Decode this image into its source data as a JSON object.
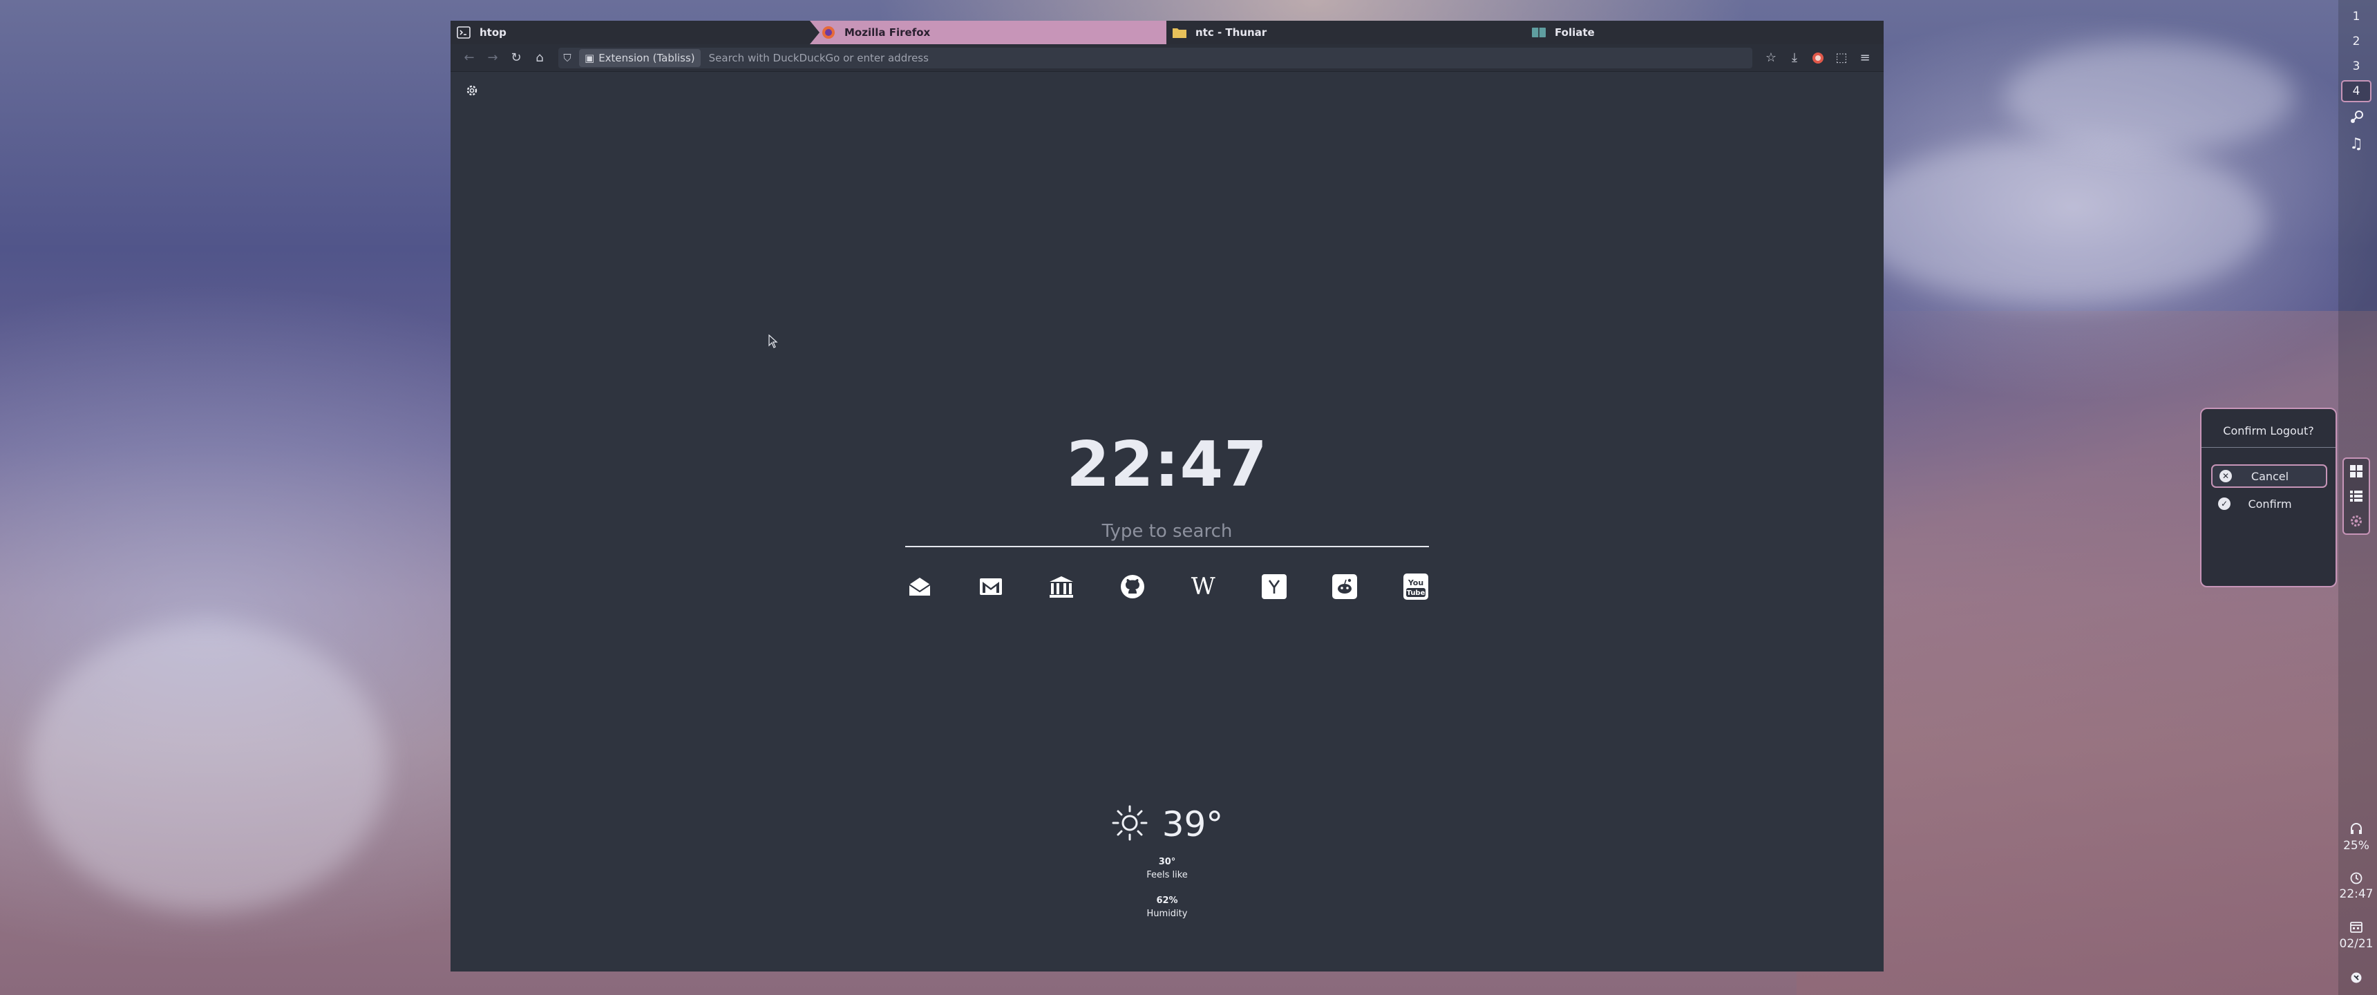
{
  "wm_tabs": [
    {
      "title": "htop",
      "icon": "terminal-icon"
    },
    {
      "title": "Mozilla Firefox",
      "icon": "firefox-icon",
      "active": true
    },
    {
      "title": "ntc - Thunar",
      "icon": "folder-icon"
    },
    {
      "title": "Foliate",
      "icon": "book-icon"
    }
  ],
  "browser": {
    "extension_chip": "Extension (Tabliss)",
    "url_placeholder": "Search with DuckDuckGo or enter address"
  },
  "newtab": {
    "time": "22:47",
    "search_placeholder": "Type to search",
    "links": [
      "mail-open-icon",
      "gmail-icon",
      "bank-icon",
      "github-icon",
      "wikipedia-icon",
      "hackernews-icon",
      "reddit-icon",
      "youtube-icon"
    ],
    "weather": {
      "temperature": "39°",
      "feels_like_value": "30°",
      "feels_like_label": "Feels like",
      "humidity_value": "62%",
      "humidity_label": "Humidity"
    }
  },
  "sidebar": {
    "workspaces": [
      "1",
      "2",
      "3",
      "4"
    ],
    "active_workspace": "4",
    "volume": "25%",
    "clock": "22:47",
    "date": "02/21"
  },
  "logout_dialog": {
    "title": "Confirm Logout?",
    "cancel_label": "Cancel",
    "confirm_label": "Confirm"
  },
  "colors": {
    "accent": "#c795b8",
    "page_bg": "#2f343f"
  }
}
